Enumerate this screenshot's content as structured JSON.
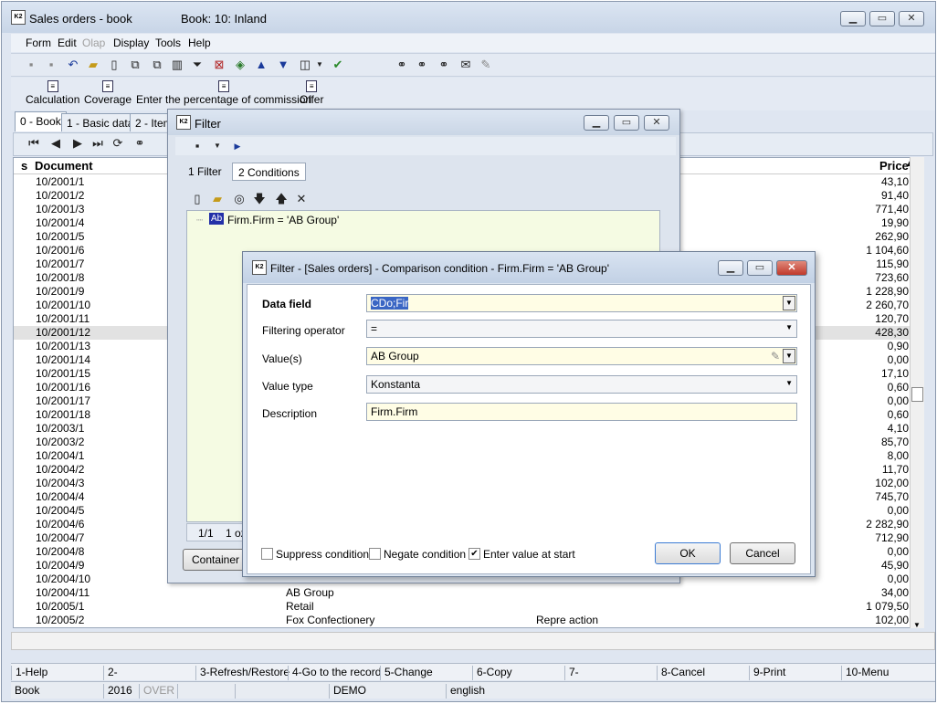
{
  "app": {
    "title": "Sales orders - book",
    "book": "Book: 10: Inland"
  },
  "menu": [
    "Form",
    "Edit",
    "Olap",
    "Display",
    "Tools",
    "Help"
  ],
  "toolbar_big": [
    "Calculation",
    "Coverage",
    "Enter the percentage of commission",
    "Offer"
  ],
  "tabs": [
    "0 - Book",
    "1 - Basic data",
    "2 - Item"
  ],
  "grid": {
    "col_s": "s",
    "col_document": "Document",
    "col_price": "Price",
    "rows": [
      {
        "doc": "10/2001/1",
        "price": "43,10",
        "firm": "",
        "note": ""
      },
      {
        "doc": "10/2001/2",
        "price": "91,40",
        "firm": "",
        "note": ""
      },
      {
        "doc": "10/2001/3",
        "price": "771,40",
        "firm": "",
        "note": ""
      },
      {
        "doc": "10/2001/4",
        "price": "19,90",
        "firm": "",
        "note": ""
      },
      {
        "doc": "10/2001/5",
        "price": "262,90",
        "firm": "",
        "note": ""
      },
      {
        "doc": "10/2001/6",
        "price": "1 104,60",
        "firm": "",
        "note": ""
      },
      {
        "doc": "10/2001/7",
        "price": "115,90",
        "firm": "",
        "note": ""
      },
      {
        "doc": "10/2001/8",
        "price": "723,60",
        "firm": "",
        "note": ""
      },
      {
        "doc": "10/2001/9",
        "price": "1 228,90",
        "firm": "",
        "note": ""
      },
      {
        "doc": "10/2001/10",
        "price": "2 260,70",
        "firm": "",
        "note": ""
      },
      {
        "doc": "10/2001/11",
        "price": "120,70",
        "firm": "",
        "note": ""
      },
      {
        "doc": "10/2001/12",
        "price": "428,30",
        "firm": "",
        "note": ""
      },
      {
        "doc": "10/2001/13",
        "price": "0,90",
        "firm": "",
        "note": ""
      },
      {
        "doc": "10/2001/14",
        "price": "0,00",
        "firm": "",
        "note": ""
      },
      {
        "doc": "10/2001/15",
        "price": "17,10",
        "firm": "",
        "note": ""
      },
      {
        "doc": "10/2001/16",
        "price": "0,60",
        "firm": "",
        "note": ""
      },
      {
        "doc": "10/2001/17",
        "price": "0,00",
        "firm": "",
        "note": ""
      },
      {
        "doc": "10/2001/18",
        "price": "0,60",
        "firm": "",
        "note": ""
      },
      {
        "doc": "10/2003/1",
        "price": "4,10",
        "firm": "",
        "note": ""
      },
      {
        "doc": "10/2003/2",
        "price": "85,70",
        "firm": "",
        "note": ""
      },
      {
        "doc": "10/2004/1",
        "price": "8,00",
        "firm": "",
        "note": ""
      },
      {
        "doc": "10/2004/2",
        "price": "11,70",
        "firm": "",
        "note": ""
      },
      {
        "doc": "10/2004/3",
        "price": "102,00",
        "firm": "",
        "note": ""
      },
      {
        "doc": "10/2004/4",
        "price": "745,70",
        "firm": "",
        "note": ""
      },
      {
        "doc": "10/2004/5",
        "price": "0,00",
        "firm": "",
        "note": ""
      },
      {
        "doc": "10/2004/6",
        "price": "2 282,90",
        "firm": "",
        "note": ""
      },
      {
        "doc": "10/2004/7",
        "price": "712,90",
        "firm": "",
        "note": ""
      },
      {
        "doc": "10/2004/8",
        "price": "0,00",
        "firm": "",
        "note": ""
      },
      {
        "doc": "10/2004/9",
        "price": "45,90",
        "firm": "",
        "note": ""
      },
      {
        "doc": "10/2004/10",
        "price": "0,00",
        "firm": "",
        "note": ""
      },
      {
        "doc": "10/2004/11",
        "price": "34,00",
        "firm": "AB Group",
        "note": ""
      },
      {
        "doc": "10/2005/1",
        "price": "1 079,50",
        "firm": "Retail",
        "note": ""
      },
      {
        "doc": "10/2005/2",
        "price": "102,00",
        "firm": "Fox Confectionery",
        "note": "Repre action"
      }
    ]
  },
  "filter": {
    "title": "Filter",
    "tab1": "1 Filter",
    "tab2": "2 Conditions",
    "node_badge": "Ab",
    "node_text": "Firm.Firm = 'AB Group'",
    "counter": "1/1",
    "counter2": "1 oz",
    "container_btn": "Container"
  },
  "dialog": {
    "title": "Filter - [Sales orders] - Comparison condition - Firm.Firm = 'AB Group'",
    "data_field_label": "Data field",
    "data_field_value": "CDo;Fir",
    "operator_label": "Filtering operator",
    "operator_value": "=",
    "values_label": "Value(s)",
    "values_value": "AB Group",
    "value_type_label": "Value type",
    "value_type_value": "Konstanta",
    "description_label": "Description",
    "description_value": "Firm.Firm",
    "suppress": "Suppress condition",
    "negate": "Negate condition",
    "enter_value": "Enter value at start",
    "ok": "OK",
    "cancel": "Cancel"
  },
  "functions": [
    "1-Help",
    "2-",
    "3-Refresh/Restore",
    "4-Go to the record",
    "5-Change",
    "6-Copy",
    "7-",
    "8-Cancel",
    "9-Print",
    "10-Menu"
  ],
  "status": {
    "book": "Book",
    "year": "2016",
    "over": "OVER",
    "demo": "DEMO",
    "lang": "english"
  }
}
